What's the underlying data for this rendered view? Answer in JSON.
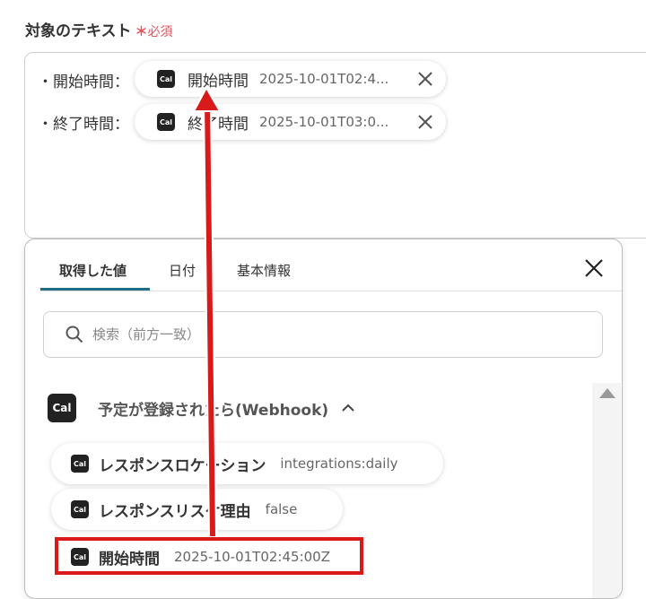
{
  "field": {
    "label": "対象のテキスト",
    "required_star": "＊",
    "required_text": "必須"
  },
  "textarea": {
    "lines": [
      {
        "label": "・開始時間：",
        "chip_name": "開始時間",
        "chip_value": "2025-10-01T02:4...",
        "chip_icon": "Cal"
      },
      {
        "label": "・終了時間：",
        "chip_name": "終了時間",
        "chip_value": "2025-10-01T03:0...",
        "chip_icon": "Cal"
      }
    ]
  },
  "panel": {
    "tabs": [
      "取得した値",
      "日付",
      "基本情報"
    ],
    "active_tab": 0,
    "search_placeholder": "検索（前方一致）",
    "group": {
      "icon": "Cal",
      "title": "予定が登録されたら(Webhook)",
      "expanded": true
    },
    "items": [
      {
        "icon": "Cal",
        "name": "レスポンスロケーション",
        "value": "integrations:daily"
      },
      {
        "icon": "Cal",
        "name": "レスポンスリスケ理由",
        "value": "false"
      },
      {
        "icon": "Cal",
        "name": "開始時間",
        "value": "2025-10-01T02:45:00Z",
        "highlighted": true
      }
    ]
  },
  "colors": {
    "accent": "#1e6f86",
    "required": "#e8505b",
    "annotation": "#d81a1a"
  }
}
